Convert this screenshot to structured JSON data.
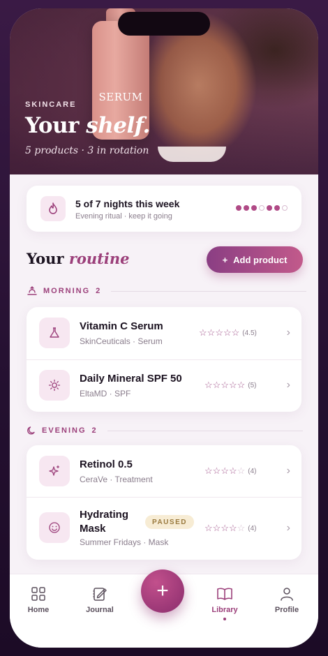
{
  "hero": {
    "kicker": "SKINCARE",
    "title_plain": "Your ",
    "title_italic": "shelf.",
    "subtitle": "5 products · 3 in rotation",
    "bottle_label": "SERUM"
  },
  "streak": {
    "title": "5 of 7 nights this week",
    "subtitle": "Evening ritual · keep it going",
    "nights": [
      true,
      true,
      true,
      false,
      true,
      true,
      false
    ]
  },
  "routine": {
    "title_plain": "Your ",
    "title_italic": "routine",
    "add_label": "Add product",
    "add_icon": "+"
  },
  "morning": {
    "label": "MORNING",
    "count": "2",
    "items": [
      {
        "name": "Vitamin C Serum",
        "meta": "SkinCeuticals · Serum",
        "rating": 4.5,
        "rating_label": "(4.5)",
        "icon": "flask-icon"
      },
      {
        "name": "Daily Mineral SPF 50",
        "meta": "EltaMD · SPF",
        "rating": 5,
        "rating_label": "(5)",
        "icon": "sun-icon"
      }
    ]
  },
  "evening": {
    "label": "EVENING",
    "count": "2",
    "items": [
      {
        "name": "Retinol 0.5",
        "meta": "CeraVe · Treatment",
        "rating": 4,
        "rating_label": "(4)",
        "icon": "sparkle-icon"
      },
      {
        "name": "Hydrating Mask",
        "meta": "Summer Fridays · Mask",
        "rating": 4,
        "rating_label": "(4)",
        "icon": "smile-icon",
        "badge": "PAUSED"
      }
    ]
  },
  "nav": {
    "home": "Home",
    "journal": "Journal",
    "fab": "+",
    "library": "Library",
    "profile": "Profile",
    "active": "library"
  },
  "colors": {
    "accent": "#9b3f7a",
    "accent_gradient_start": "#8a3e83",
    "accent_gradient_end": "#c25a8b",
    "badge_bg": "#f7ecd4"
  }
}
